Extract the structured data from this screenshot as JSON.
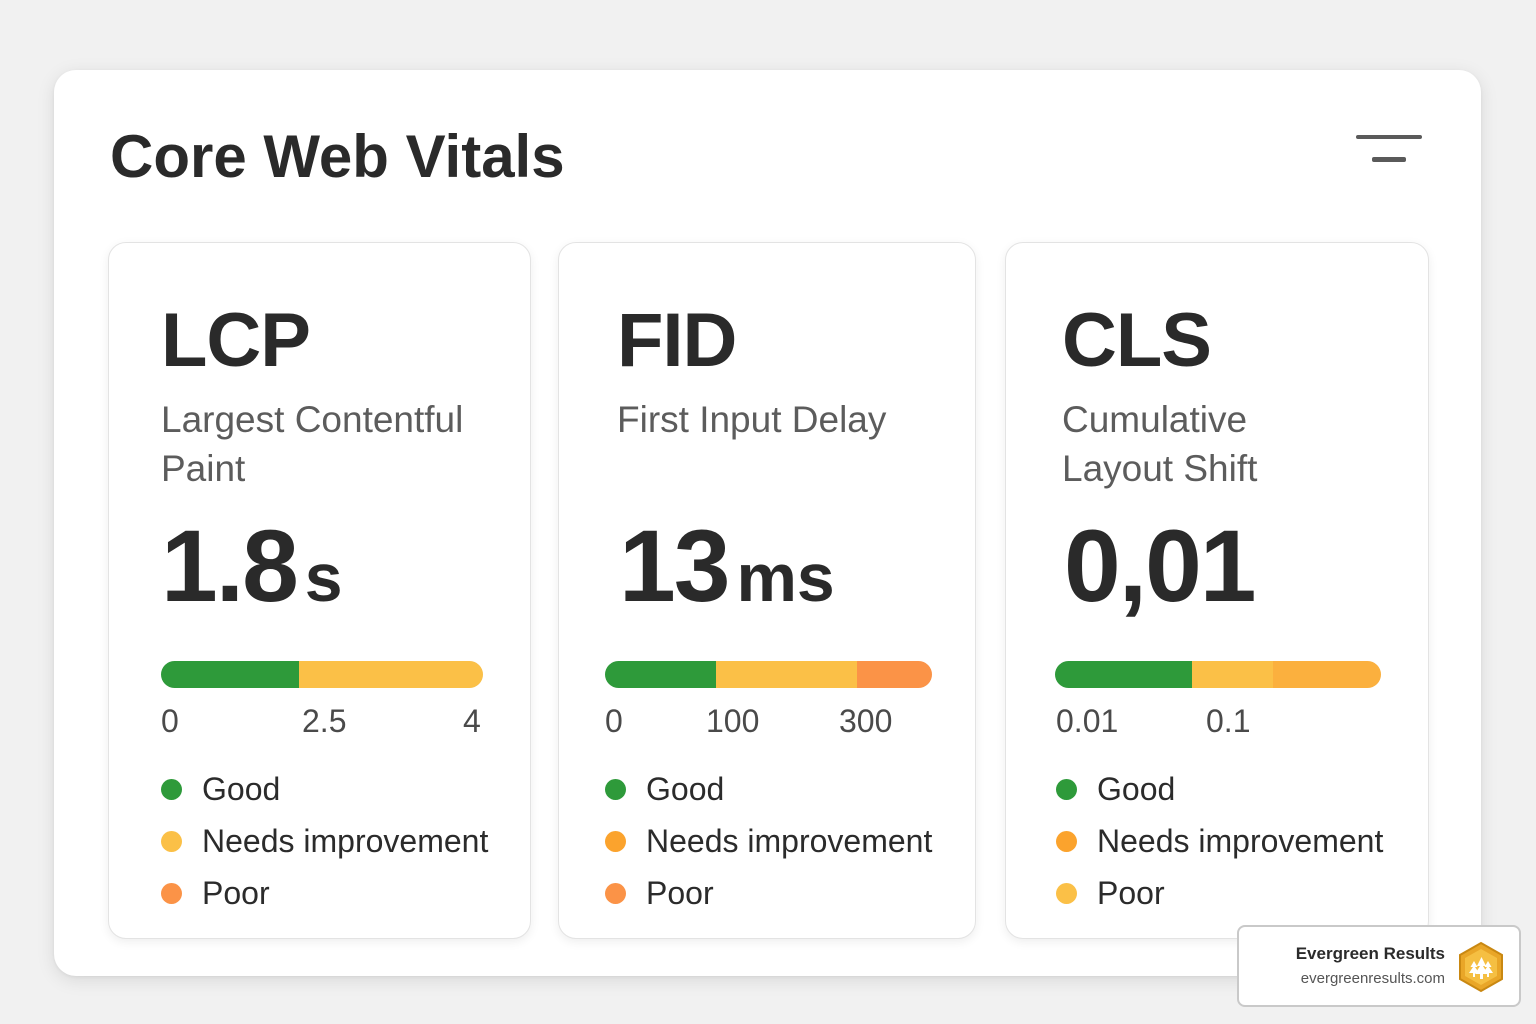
{
  "panel": {
    "title": "Core Web Vitals"
  },
  "colors": {
    "good": "#2e9a3a",
    "needs_improvement_yellow": "#fbc047",
    "needs_improvement_orange": "#fba83a",
    "poor": "#fb9347"
  },
  "cards": [
    {
      "abbr": "LCP",
      "full": "Largest Contentful Paint",
      "value": "1.8",
      "unit": "s",
      "ticks": [
        "0",
        "2.5",
        "4"
      ],
      "segments": [
        {
          "fraction": 0.43,
          "color": "#2e9a3a"
        },
        {
          "fraction": 0.57,
          "color": "#fbc047"
        }
      ],
      "legend": [
        {
          "label": "Good",
          "color": "#2e9a3a"
        },
        {
          "label": "Needs improvement",
          "color": "#fbc047"
        },
        {
          "label": "Poor",
          "color": "#fb9347"
        }
      ]
    },
    {
      "abbr": "FID",
      "full": "First Input Delay",
      "value": "13",
      "unit": "ms",
      "ticks": [
        "0",
        "100",
        "300"
      ],
      "segments": [
        {
          "fraction": 0.34,
          "color": "#2e9a3a"
        },
        {
          "fraction": 0.43,
          "color": "#fbc047"
        },
        {
          "fraction": 0.23,
          "color": "#fb9347"
        }
      ],
      "legend": [
        {
          "label": "Good",
          "color": "#2e9a3a"
        },
        {
          "label": "Needs improvement",
          "color": "#fba32d"
        },
        {
          "label": "Poor",
          "color": "#fb9347"
        }
      ]
    },
    {
      "abbr": "CLS",
      "full": "Cumulative Layout Shift",
      "value": "0,01",
      "unit": "",
      "ticks": [
        "0.01",
        "0.1"
      ],
      "segments": [
        {
          "fraction": 0.42,
          "color": "#2e9a3a"
        },
        {
          "fraction": 0.25,
          "color": "#fbc047"
        },
        {
          "fraction": 0.33,
          "color": "#fbb03e"
        }
      ],
      "legend": [
        {
          "label": "Good",
          "color": "#2e9a3a"
        },
        {
          "label": "Needs improvement",
          "color": "#fba32d"
        },
        {
          "label": "Poor",
          "color": "#fbc047"
        }
      ]
    }
  ],
  "brand": {
    "name": "Evergreen Results",
    "url": "evergreenresults.com",
    "logo_icon": "tree-hexagon-logo"
  }
}
